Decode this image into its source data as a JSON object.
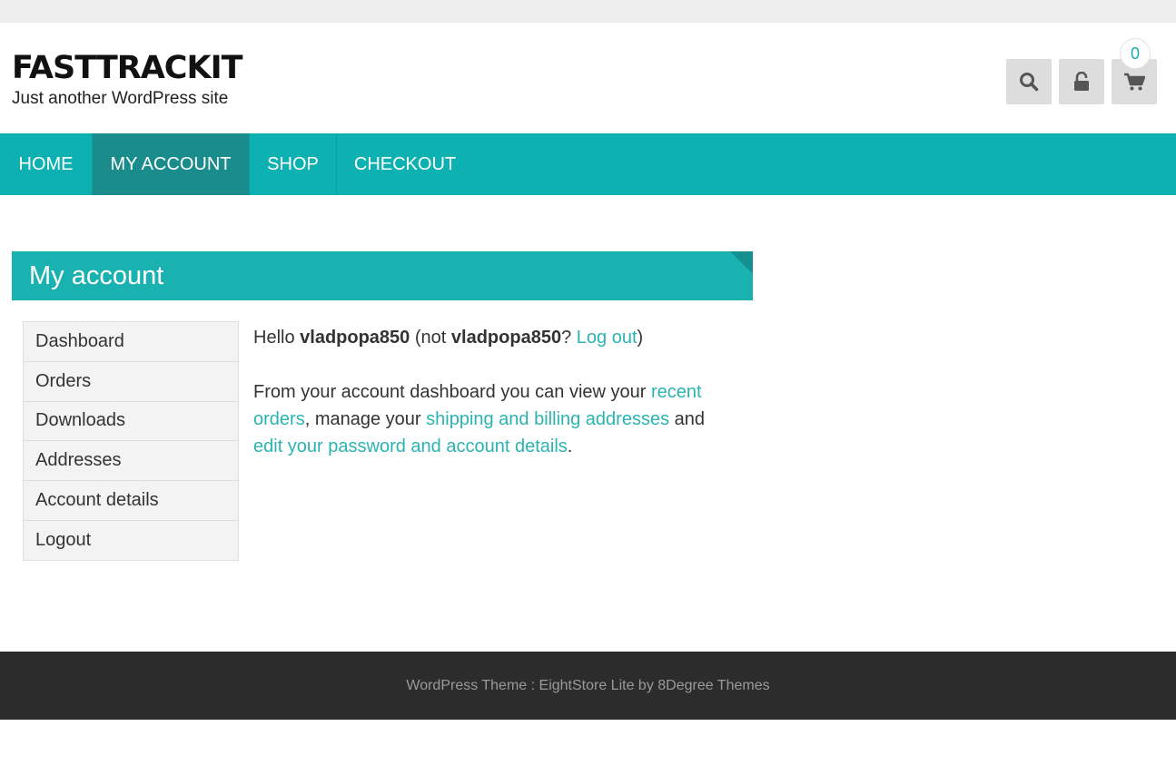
{
  "header": {
    "site_title": "FASTTRACKIT",
    "tagline": "Just another WordPress site",
    "cart_count": "0",
    "icons": [
      "search-icon",
      "unlock-icon",
      "cart-icon"
    ]
  },
  "nav": {
    "items": [
      {
        "label": "HOME"
      },
      {
        "label": "MY ACCOUNT",
        "active": true
      },
      {
        "label": "SHOP"
      },
      {
        "label": "CHECKOUT"
      }
    ]
  },
  "page": {
    "title": "My account"
  },
  "account_nav": {
    "items": [
      {
        "label": "Dashboard"
      },
      {
        "label": "Orders"
      },
      {
        "label": "Downloads"
      },
      {
        "label": "Addresses"
      },
      {
        "label": "Account details"
      },
      {
        "label": "Logout"
      }
    ]
  },
  "dashboard": {
    "hello": "Hello",
    "username": "vladpopa850",
    "not": "(not",
    "not_username": "vladpopa850",
    "question": "?",
    "logout_link": "Log out",
    "close_paren": ")",
    "intro": "From your account dashboard you can view your",
    "recent_orders_link": "recent orders",
    "manage": ", manage your",
    "addresses_link": "shipping and billing addresses",
    "and": "and",
    "edit_link": "edit your password and account details",
    "period": "."
  },
  "footer": {
    "text": "WordPress Theme : EightStore Lite by 8Degree Themes"
  },
  "colors": {
    "accent": "#0db1b1",
    "nav_active": "#1b8c8c",
    "link": "#2bb3b2",
    "footer_bg": "#2c2c2c"
  }
}
